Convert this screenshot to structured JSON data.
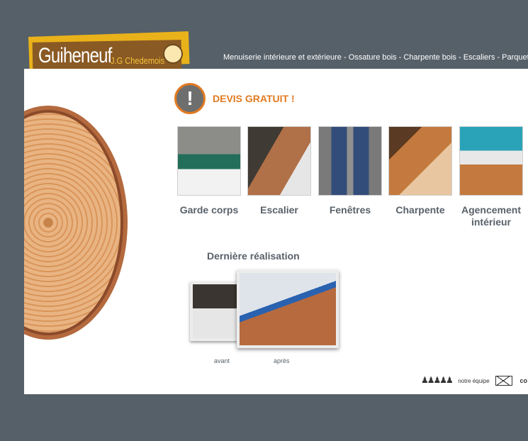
{
  "brand": {
    "name": "Guiheneuf",
    "sub": "J.G Chedemois"
  },
  "nav": {
    "text": "Menuiserie intérieure et extérieure - Ossature bois - Charpente bois - Escaliers - Parquet - Amé"
  },
  "devis": {
    "icon": "exclamation-icon",
    "label": "DEVIS GRATUIT !"
  },
  "categories": [
    {
      "label": "Garde corps"
    },
    {
      "label": "Escalier"
    },
    {
      "label": "Fenêtres"
    },
    {
      "label": "Charpente"
    },
    {
      "label": "Agencement intérieur"
    }
  ],
  "realisation": {
    "title": "Dernière réalisation",
    "before_label": "avant",
    "after_label": "après"
  },
  "footer": {
    "team_label": "notre équipe",
    "contact_label": "co"
  },
  "colors": {
    "background": "#566068",
    "accent": "#e27a20",
    "brand_yellow": "#e9b21a",
    "brand_brown": "#8a5a24"
  }
}
